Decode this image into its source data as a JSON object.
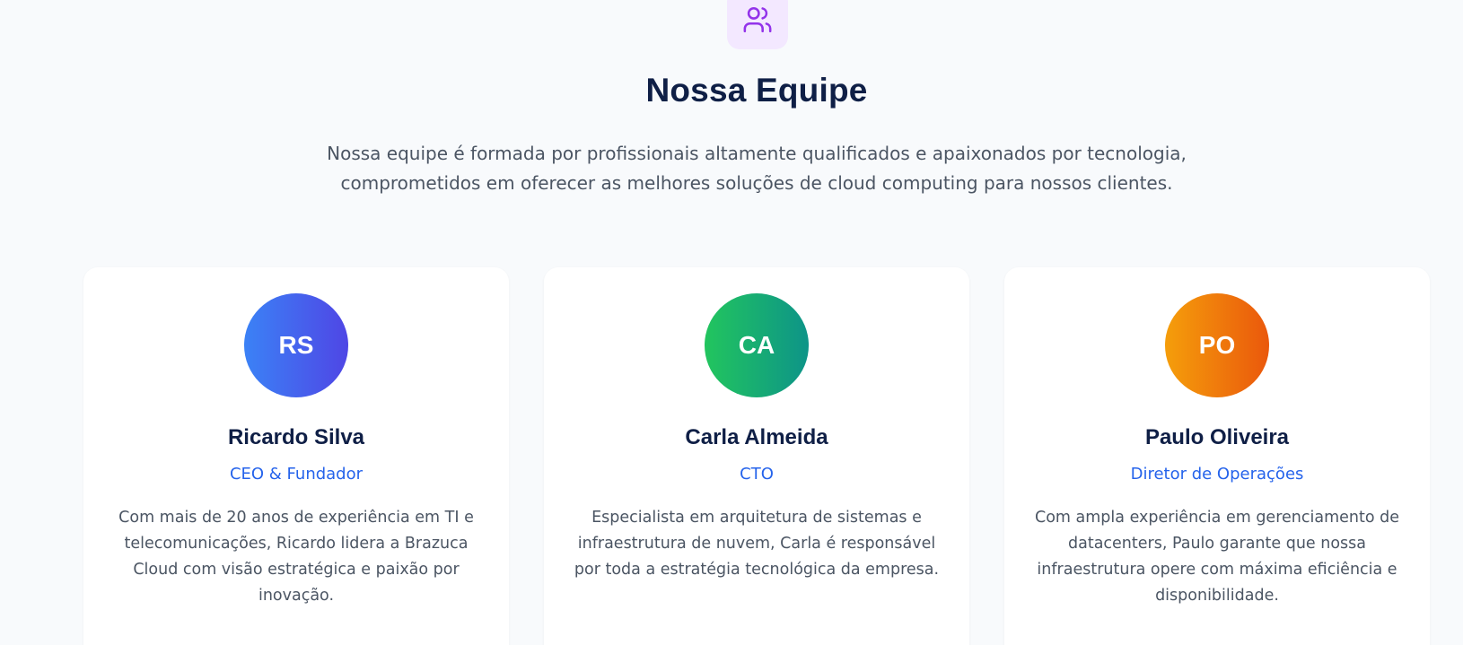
{
  "section": {
    "icon": "users-icon",
    "title": "Nossa Equipe",
    "description": "Nossa equipe é formada por profissionais altamente qualificados e apaixonados por tecnologia, comprometidos em oferecer as melhores soluções de cloud computing para nossos clientes."
  },
  "colors": {
    "title": "#0f1f46",
    "accent_role": "#2563eb",
    "icon_bg": "#f3e8ff",
    "icon_stroke": "#9333ea"
  },
  "team": [
    {
      "initials": "RS",
      "name": "Ricardo Silva",
      "role": "CEO & Fundador",
      "bio": "Com mais de 20 anos de experiência em TI e telecomunicações, Ricardo lidera a Brazuca Cloud com visão estratégica e paixão por inovação."
    },
    {
      "initials": "CA",
      "name": "Carla Almeida",
      "role": "CTO",
      "bio": "Especialista em arquitetura de sistemas e infraestrutura de nuvem, Carla é responsável por toda a estratégia tecnológica da empresa."
    },
    {
      "initials": "PO",
      "name": "Paulo Oliveira",
      "role": "Diretor de Operações",
      "bio": "Com ampla experiência em gerenciamento de datacenters, Paulo garante que nossa infraestrutura opere com máxima eficiência e disponibilidade."
    }
  ]
}
